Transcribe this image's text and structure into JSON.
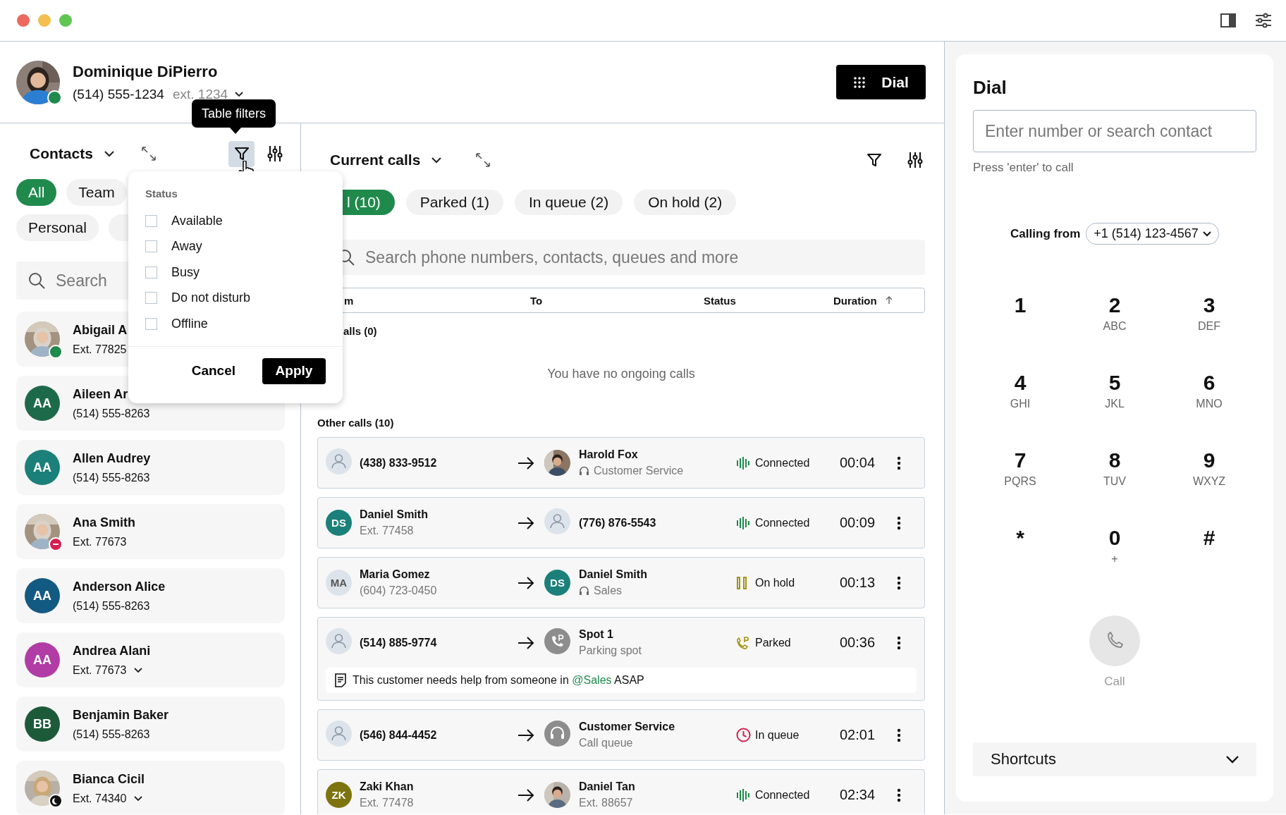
{
  "window": {
    "controls": [
      {
        "color": "#ec6a5e"
      },
      {
        "color": "#f4bf4f"
      },
      {
        "color": "#61c554"
      }
    ]
  },
  "user": {
    "name": "Dominique DiPierro",
    "phone": "(514) 555-1234",
    "ext": "ext. 1234",
    "status": {
      "kind": "online",
      "color": "#1f8a4c"
    }
  },
  "dial_button": {
    "label": "Dial"
  },
  "tooltip": "Table filters",
  "contacts": {
    "title": "Contacts",
    "chips": [
      {
        "label": "All",
        "selected": true
      },
      {
        "label": "Team",
        "selected": false
      },
      {
        "label": "Personal",
        "selected": false
      },
      {
        "selected": false
      }
    ],
    "search": {
      "placeholder": "Search"
    },
    "items": [
      {
        "name": "Abigail A",
        "detail": "Ext. 77825",
        "status": {
          "kind": "online",
          "color": "#1f8a4c"
        }
      },
      {
        "name": "Aileen Ar",
        "detail": "(514) 555-8263",
        "avatar": {
          "kind": "initials",
          "initials": "AA",
          "color": "#1d6a4a"
        }
      },
      {
        "name": "Allen Audrey",
        "detail": "(514) 555-8263",
        "avatar": {
          "kind": "initials",
          "initials": "AA",
          "color": "#1b8079"
        }
      },
      {
        "name": "Ana Smith",
        "detail": "Ext. 77673",
        "status": {
          "kind": "dnd",
          "color": "#d6204f"
        }
      },
      {
        "name": "Anderson Alice",
        "detail": "(514) 555-8263",
        "avatar": {
          "kind": "initials",
          "initials": "AA",
          "color": "#135a82"
        }
      },
      {
        "name": "Andrea Alani",
        "detail": "Ext. 77673",
        "menu": true,
        "avatar": {
          "kind": "initials",
          "initials": "AA",
          "color": "#b23ca6"
        }
      },
      {
        "name": "Benjamin Baker",
        "detail": "(514) 555-8263",
        "avatar": {
          "kind": "initials",
          "initials": "BB",
          "color": "#1d5a3a"
        }
      },
      {
        "name": "Bianca Cicil",
        "detail": "Ext. 74340",
        "menu": true,
        "status": {
          "kind": "away",
          "color": "#111111"
        }
      }
    ]
  },
  "filter_menu": {
    "heading": "Status",
    "options": [
      {
        "label": "Available",
        "checked": false
      },
      {
        "label": "Away",
        "checked": false
      },
      {
        "label": "Busy",
        "checked": false
      },
      {
        "label": "Do not disturb",
        "checked": false
      },
      {
        "label": "Offline",
        "checked": false
      }
    ],
    "cancel": "Cancel",
    "apply": "Apply"
  },
  "calls": {
    "title": "Current calls",
    "tabs": [
      {
        "label": "l (10)",
        "selected": true
      },
      {
        "label": "Parked (1)",
        "selected": false
      },
      {
        "label": "In queue (2)",
        "selected": false
      },
      {
        "label": "On hold (2)",
        "selected": false
      }
    ],
    "search": {
      "placeholder": "Search phone numbers, contacts, queues and more"
    },
    "columns": [
      {
        "label": "m",
        "sorted": false
      },
      {
        "label": "To",
        "sorted": false
      },
      {
        "label": "Status",
        "sorted": false
      },
      {
        "label": "Duration",
        "sorted": true
      }
    ],
    "ongoing": {
      "heading": "alls (0)",
      "empty_text": "You have no ongoing calls"
    },
    "other": {
      "heading": "Other calls (10)",
      "rows": [
        {
          "from": {
            "avatar": {
              "kind": "person"
            },
            "name": "(438) 833-9512"
          },
          "to": {
            "name": "Harold Fox",
            "detail": "Customer Service",
            "headset": true
          },
          "status": {
            "kind": "connected",
            "label": "Connected"
          },
          "duration": "00:04"
        },
        {
          "from": {
            "avatar": {
              "kind": "initials",
              "initials": "DS",
              "color": "#1b8079"
            },
            "name": "Daniel Smith",
            "detail": "Ext. 77458"
          },
          "to": {
            "avatar": {
              "kind": "person"
            },
            "name": "(776) 876-5543"
          },
          "status": {
            "kind": "connected",
            "label": "Connected"
          },
          "duration": "00:09"
        },
        {
          "from": {
            "avatar": {
              "kind": "muted",
              "initials": "MA",
              "color": "#dde3ea"
            },
            "name": "Maria Gomez",
            "detail": "(604) 723-0450"
          },
          "to": {
            "avatar": {
              "kind": "initials",
              "initials": "DS",
              "color": "#1b8079"
            },
            "name": "Daniel Smith",
            "detail": "Sales",
            "headset": true
          },
          "status": {
            "kind": "hold",
            "label": "On hold"
          },
          "duration": "00:13"
        },
        {
          "from": {
            "avatar": {
              "kind": "person"
            },
            "name": "(514) 885-9774"
          },
          "to": {
            "avatar": {
              "kind": "parking"
            },
            "name": "Spot 1",
            "detail": "Parking spot"
          },
          "status": {
            "kind": "parked",
            "label": "Parked"
          },
          "duration": "00:36",
          "note": {
            "before": "This customer needs help from someone in",
            "mention": "@Sales",
            "after": "ASAP"
          }
        },
        {
          "from": {
            "avatar": {
              "kind": "person"
            },
            "name": "(546) 844-4452"
          },
          "to": {
            "avatar": {
              "kind": "queue"
            },
            "name": "Customer Service",
            "detail": "Call queue"
          },
          "status": {
            "kind": "queue",
            "label": "In queue"
          },
          "duration": "02:01"
        },
        {
          "from": {
            "avatar": {
              "kind": "initials",
              "initials": "ZK",
              "color": "#7d7410"
            },
            "name": "Zaki Khan",
            "detail": "Ext. 77478"
          },
          "to": {
            "name": "Daniel Tan",
            "detail": "Ext. 88657"
          },
          "status": {
            "kind": "connected",
            "label": "Connected"
          },
          "duration": "02:34"
        }
      ]
    }
  },
  "dial": {
    "title": "Dial",
    "input": {
      "placeholder": "Enter number or search contact"
    },
    "hint": "Press 'enter' to call",
    "calling_from": {
      "label": "Calling from",
      "value": "+1 (514) 123-4567"
    },
    "keys": [
      {
        "digit": "1"
      },
      {
        "digit": "2",
        "letters": "ABC"
      },
      {
        "digit": "3",
        "letters": "DEF"
      },
      {
        "digit": "4",
        "letters": "GHI"
      },
      {
        "digit": "5",
        "letters": "JKL"
      },
      {
        "digit": "6",
        "letters": "MNO"
      },
      {
        "digit": "7",
        "letters": "PQRS"
      },
      {
        "digit": "8",
        "letters": "TUV"
      },
      {
        "digit": "9",
        "letters": "WXYZ"
      },
      {
        "digit": "*"
      },
      {
        "digit": "0",
        "letters": "+"
      },
      {
        "digit": "#"
      }
    ],
    "call_button": {
      "label": "Call",
      "disabled": true
    },
    "shortcuts": {
      "label": "Shortcuts",
      "expanded": false
    }
  }
}
